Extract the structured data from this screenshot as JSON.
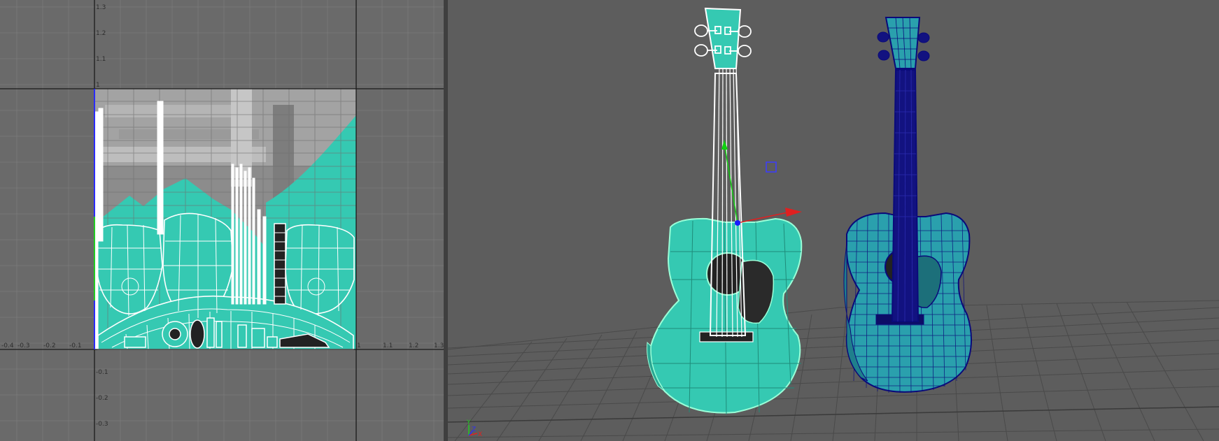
{
  "uv_editor": {
    "x_ticks": [
      "-0.4",
      "-0.3",
      "-0.2",
      "-0.1",
      "1",
      "1.1",
      "1.2",
      "1.3"
    ],
    "y_ticks": [
      "1.3",
      "1.2",
      "1.1",
      "1",
      "-0.1",
      "-0.2",
      "-0.3"
    ]
  },
  "viewport": {
    "gizmo_axes": {
      "x": "X",
      "y": "Y",
      "z": "Z"
    }
  },
  "colors": {
    "uv_background": "#6a6a6a",
    "viewport_background": "#5d5d5d",
    "uv_shell_fill": "#35c9b2",
    "wire_white": "#ffffff",
    "selected_wire": "#9affd8",
    "deselected_wire": "#0a0a7a",
    "manip_red": "#e02020",
    "manip_green": "#10d010",
    "manip_blue": "#1a1aff"
  }
}
